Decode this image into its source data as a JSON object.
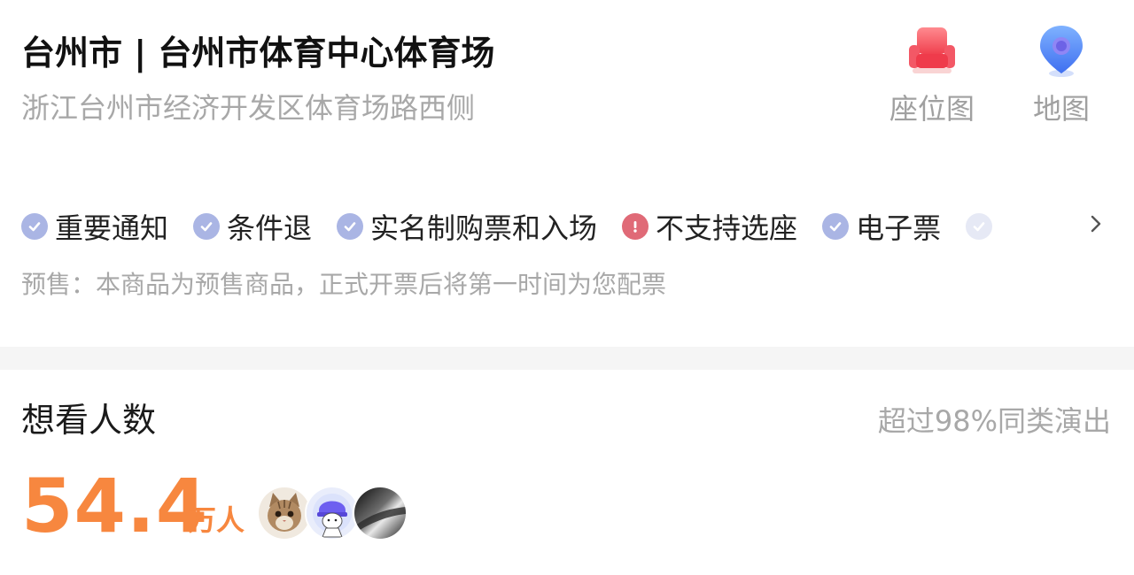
{
  "venue": {
    "title": "台州市 | 台州市体育中心体育场",
    "address": "浙江台州市经济开发区体育场路西侧"
  },
  "actions": {
    "seat_map": {
      "label": "座位图",
      "icon": "seat-icon",
      "color": "#f24a5b"
    },
    "map": {
      "label": "地图",
      "icon": "map-pin-icon",
      "color": "#4f86f7"
    }
  },
  "tags": [
    {
      "label": "重要通知",
      "status": "ok"
    },
    {
      "label": "条件退",
      "status": "ok"
    },
    {
      "label": "实名制购票和入场",
      "status": "ok"
    },
    {
      "label": "不支持选座",
      "status": "warn"
    },
    {
      "label": "电子票",
      "status": "ok"
    },
    {
      "label": "",
      "status": "faded"
    }
  ],
  "tags_more_icon": "chevron-right-icon",
  "presale_note": "预售：本商品为预售商品，正式开票后将第一时间为您配票",
  "want_to_see": {
    "title": "想看人数",
    "rank": "超过98%同类演出",
    "count": "54.4",
    "unit": "万人",
    "avatars": [
      "avatar-kitten",
      "avatar-cartoon-boy",
      "avatar-dark-photo"
    ]
  },
  "colors": {
    "accent": "#f7873f",
    "tag_ok": "#aab5e4",
    "tag_warn": "#e06a77",
    "muted_text": "#a8a8a8"
  }
}
